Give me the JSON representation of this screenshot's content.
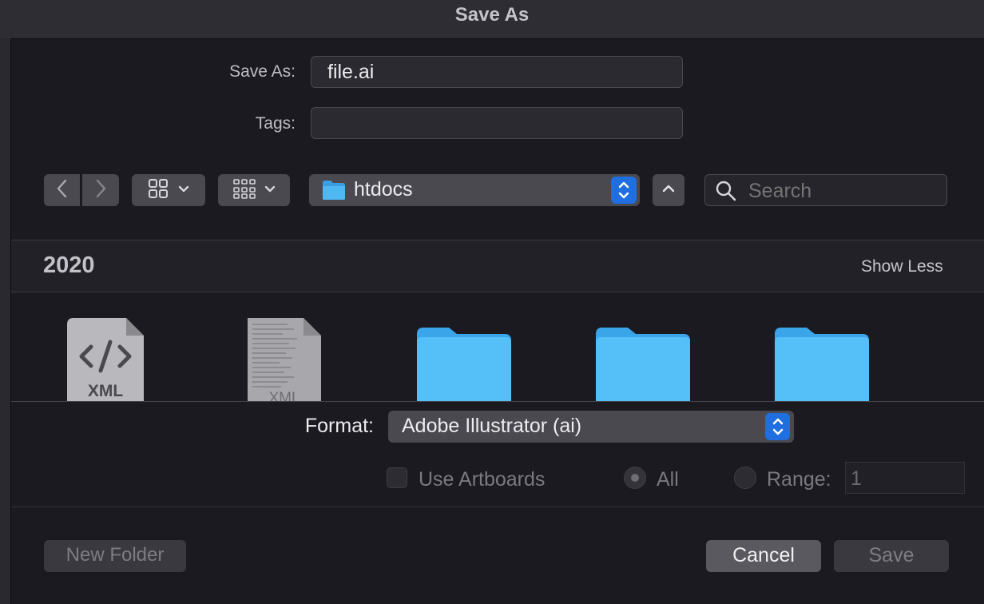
{
  "window": {
    "title": "Save As"
  },
  "form": {
    "save_as_label": "Save As:",
    "save_as_value": "file.ai",
    "tags_label": "Tags:",
    "tags_value": ""
  },
  "toolbar": {
    "back_icon": "chevron-left-icon",
    "forward_icon": "chevron-right-icon",
    "view_icon": "grid-view-icon",
    "group_icon": "group-view-icon",
    "location": "htdocs",
    "location_icon": "folder-icon",
    "collapse_icon": "chevron-up-icon",
    "search_placeholder": "Search"
  },
  "browser": {
    "section_title": "2020",
    "show_less_label": "Show Less",
    "items": [
      {
        "kind": "xml-file",
        "badge": "XML"
      },
      {
        "kind": "xml-document",
        "badge": "XML"
      },
      {
        "kind": "folder"
      },
      {
        "kind": "folder"
      },
      {
        "kind": "folder"
      }
    ]
  },
  "options": {
    "format_label": "Format:",
    "format_value": "Adobe Illustrator (ai)",
    "use_artboards_label": "Use Artboards",
    "use_artboards_checked": false,
    "all_label": "All",
    "range_label": "Range:",
    "range_value": "1"
  },
  "footer": {
    "new_folder_label": "New Folder",
    "cancel_label": "Cancel",
    "save_label": "Save"
  },
  "colors": {
    "accent": "#1f6fe0",
    "folder": "#45b1f0",
    "background": "#1b1a21",
    "control": "#4a4950"
  }
}
